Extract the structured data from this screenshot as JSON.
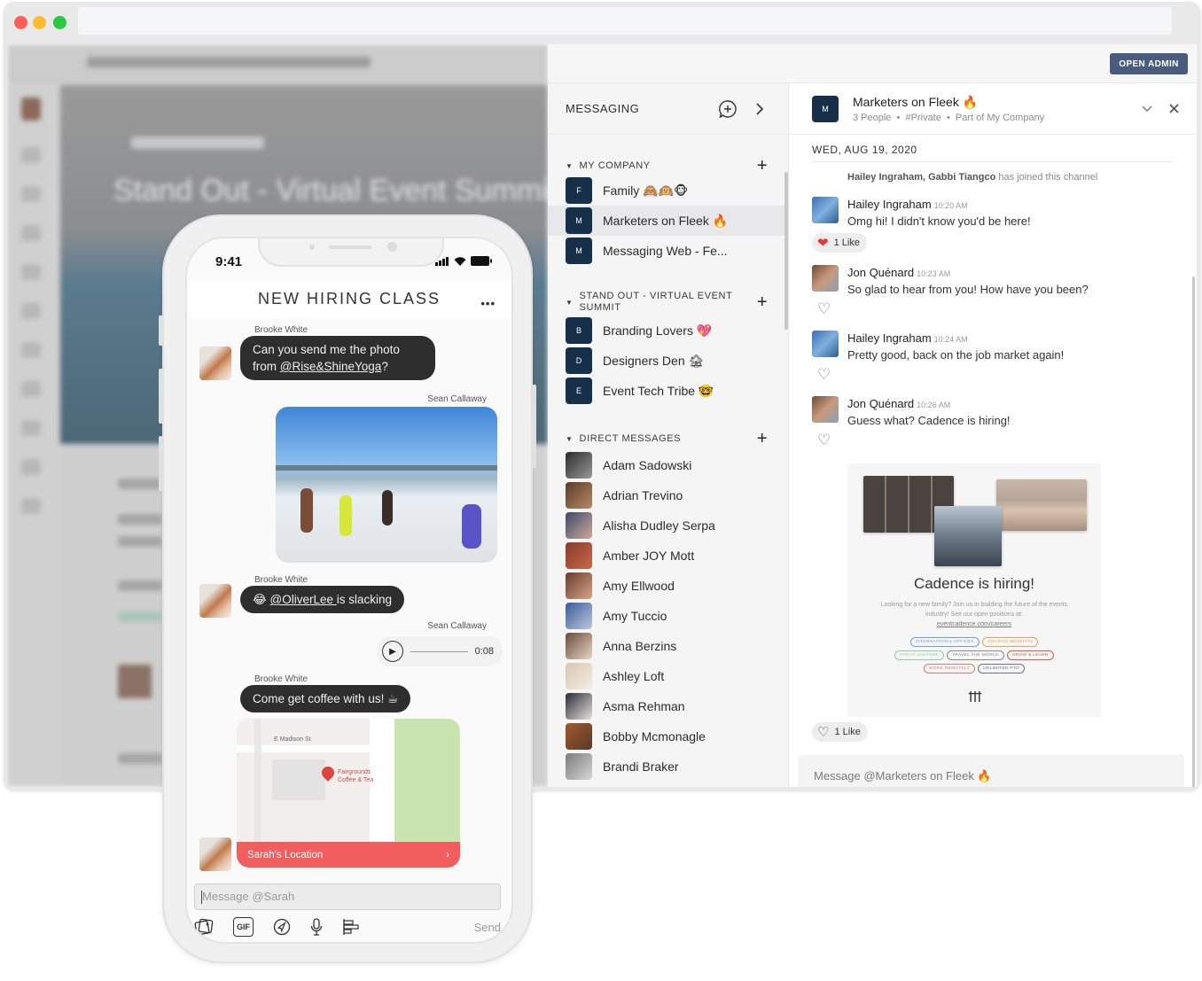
{
  "browser": {
    "url": ""
  },
  "app": {
    "open_admin_label": "OPEN ADMIN"
  },
  "background": {
    "hero_title": "Stand Out - Virtual Event Summit"
  },
  "messaging": {
    "title": "MESSAGING",
    "sections": [
      {
        "label": "MY COMPANY",
        "channels": [
          {
            "initial": "F",
            "name": "Family 🙈🙉🐵",
            "active": false
          },
          {
            "initial": "M",
            "name": "Marketers on Fleek 🔥",
            "active": true
          },
          {
            "initial": "M",
            "name": "Messaging Web - Fe...",
            "active": false
          }
        ]
      },
      {
        "label": "STAND OUT - VIRTUAL EVENT SUMMIT",
        "channels": [
          {
            "initial": "B",
            "name": "Branding Lovers 💖",
            "active": false
          },
          {
            "initial": "D",
            "name": "Designers Den 🏚",
            "active": false
          },
          {
            "initial": "E",
            "name": "Event Tech Tribe 🤓",
            "active": false
          }
        ]
      },
      {
        "label": "DIRECT MESSAGES",
        "people": [
          "Adam Sadowski",
          "Adrian Trevino",
          "Alisha Dudley Serpa",
          "Amber JOY Mott",
          "Amy Ellwood",
          "Amy Tuccio",
          "Anna Berzins",
          "Ashley Loft",
          "Asma Rehman",
          "Bobby Mcmonagle",
          "Brandi Braker"
        ]
      }
    ]
  },
  "chat": {
    "initial": "M",
    "title": "Marketers on Fleek 🔥",
    "meta": "3 People  •  #Private  •  Part of My Company",
    "date": "WED, AUG 19, 2020",
    "system_names": "Hailey Ingraham, Gabbi Tiangco",
    "system_text": " has joined this channel",
    "messages": [
      {
        "author": "Hailey Ingraham",
        "time": "10:20 AM",
        "text": "Omg hi! I didn't know you'd be here!",
        "likes": "1 Like",
        "liked": true
      },
      {
        "author": "Jon Quénard",
        "time": "10:23 AM",
        "text": "So glad to hear from you! How have you been?"
      },
      {
        "author": "Hailey Ingraham",
        "time": "10:24 AM",
        "text": "Pretty good, back on the job market again!"
      },
      {
        "author": "Jon Quénard",
        "time": "10:26 AM",
        "text": "Guess what? Cadence is hiring!"
      }
    ],
    "card": {
      "title": "Cadence is hiring!",
      "desc": "Looking for a new family? Join us in building the future of the events industry! See our open positions at:",
      "url": "eventcadence.com/careers",
      "tags": [
        {
          "label": "INTERNATIONAL OFFICES",
          "color": "#6e9fe0"
        },
        {
          "label": "AMAZING BENEFITS",
          "color": "#e8a05a"
        },
        {
          "label": "GREAT CULTURE",
          "color": "#8fcfa4"
        },
        {
          "label": "TRAVEL THE WORLD",
          "color": "#8a8a8a"
        },
        {
          "label": "GROW & LEARN",
          "color": "#c9614f"
        },
        {
          "label": "WORK REMOTELY",
          "color": "#e07a6e"
        },
        {
          "label": "UNLIMITED PTO",
          "color": "#6c7188"
        }
      ],
      "likes": "1 Like"
    },
    "composer_placeholder": "Message @Marketers on Fleek 🔥"
  },
  "phone": {
    "time": "9:41",
    "title": "NEW HIRING CLASS",
    "messages": [
      {
        "author": "Brooke White",
        "text_pre": "Can you send me the photo from ",
        "mention": "@Rise&ShineYoga",
        "text_post": "?"
      },
      {
        "author": "Sean Callaway",
        "type": "photo"
      },
      {
        "author": "Brooke White",
        "text_pre": "😂 ",
        "mention": "@OliverLee ",
        "text_post": "is slacking"
      },
      {
        "author": "Sean Callaway",
        "type": "audio",
        "duration": "0:08"
      },
      {
        "author": "Brooke White",
        "text": "Come get coffee with us! ☕"
      }
    ],
    "map": {
      "street": "E Madison St",
      "poi": "Fairgrounds Coffee & Tea",
      "location_label": "Sarah's Location"
    },
    "input_placeholder": "Message @Sarah",
    "gif_label": "GIF",
    "send_label": "Send"
  }
}
